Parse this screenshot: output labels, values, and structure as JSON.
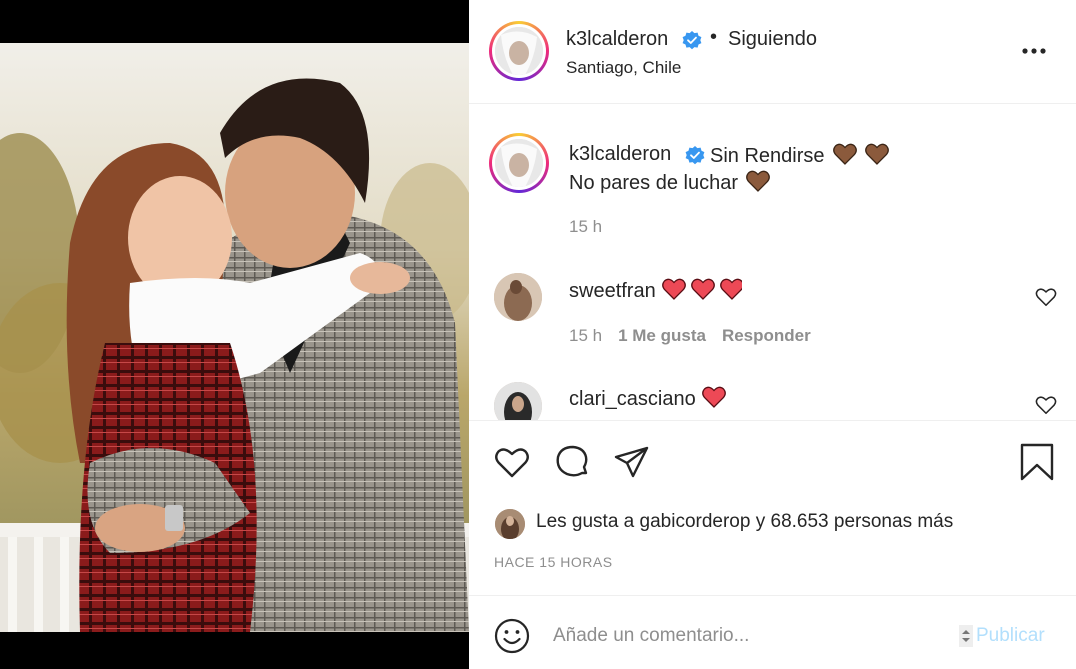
{
  "post": {
    "username": "k3lcalderon",
    "follow_separator": "•",
    "follow_status": "Siguiendo",
    "location": "Santiago, Chile"
  },
  "caption": {
    "username": "k3lcalderon",
    "line1": "Sin Rendirse",
    "line2": "No pares de luchar",
    "time": "15 h"
  },
  "comments": [
    {
      "username": "sweetfran",
      "time": "15 h",
      "likes": "1 Me gusta",
      "reply": "Responder"
    },
    {
      "username": "clari_casciano"
    }
  ],
  "likes": {
    "text_prefix": "Les gusta a ",
    "user": "gabicorderop",
    "text_suffix": " y 68.653 personas más"
  },
  "timeago": "HACE 15 HORAS",
  "comment_box": {
    "placeholder": "Añade un comentario...",
    "publish_label": "Publicar"
  },
  "icons": {
    "verified": "verified-badge-icon",
    "more": "more-options-icon",
    "like": "heart-icon",
    "comment": "comment-icon",
    "share": "share-icon",
    "save": "bookmark-icon",
    "emoji": "emoji-icon"
  },
  "colors": {
    "verified_blue": "#3897f0",
    "heart_red": "#ed4956",
    "heart_brown": "#8b5a3c",
    "publish_disabled": "#b2dffc",
    "muted_text": "#8e8e8e"
  }
}
